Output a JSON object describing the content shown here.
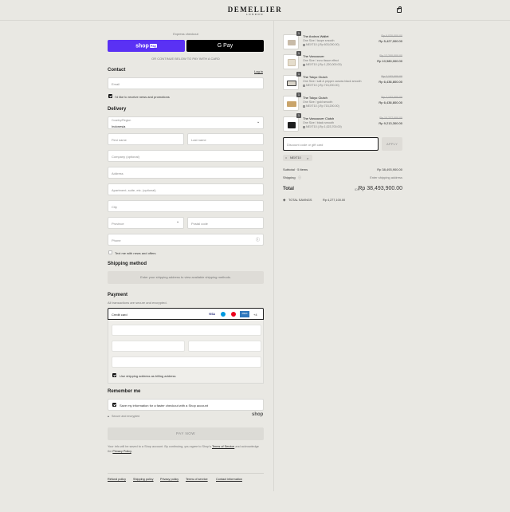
{
  "header": {
    "brand": "DEMELLIER",
    "brand_sub": "LONDON",
    "cart_icon": "shopping-bag-icon"
  },
  "express": {
    "label": "Express checkout",
    "shop_pay": "shop",
    "shop_pay_badge": "Pay",
    "gpay": "G Pay",
    "or_text": "OR CONTINUE BELOW TO PAY WITH A CARD"
  },
  "contact": {
    "title": "Contact",
    "login": "Log in",
    "email_placeholder": "Email",
    "news_label": "I'd like to receive news and promotions"
  },
  "delivery": {
    "title": "Delivery",
    "country_label": "Country/Region",
    "country_value": "Indonesia",
    "first_name": "First name",
    "last_name": "Last name",
    "company": "Company (optional)",
    "address": "Address",
    "apartment": "Apartment, suite, etc. (optional)",
    "city": "City",
    "province": "Province",
    "postal": "Postal code",
    "phone": "Phone",
    "text_me": "Text me with news and offers"
  },
  "shipping": {
    "title": "Shipping method",
    "placeholder": "Enter your shipping address to view available shipping methods."
  },
  "payment": {
    "title": "Payment",
    "subtitle": "All transactions are secure and encrypted.",
    "credit_card": "Credit card",
    "cards": [
      "VISA",
      "MC",
      "MC",
      "AMEX"
    ],
    "more_cards": "+4",
    "billing_same": "Use shipping address as billing address"
  },
  "remember": {
    "title": "Remember me",
    "save_label": "Save my information for a faster checkout with a Shop account",
    "secure": "Secure and encrypted",
    "shop_logo": "shop"
  },
  "pay_now": "PAY NOW",
  "legal": {
    "text_before": "Your info will be saved to a Shop account. By continuing, you agree to Shop's",
    "terms": "Terms of Service",
    "text_mid": "and acknowledge the",
    "privacy": "Privacy Policy",
    "text_end": "."
  },
  "footer_links": [
    "Refund policy",
    "Shipping policy",
    "Privacy policy",
    "Terms of service",
    "Contact information"
  ],
  "cart": {
    "items": [
      {
        "name": "The Andros Wallet",
        "variant": "One Size / taupe smooth",
        "discount": "NEXT10 (-Rp 603,000.00)",
        "old_price": "Rp 6,030,000.00",
        "price": "Rp 5,427,000.00",
        "qty": "1",
        "color": "#c8bba8"
      },
      {
        "name": "The Vancouver",
        "variant": "One Size / ecru tissue effect",
        "discount": "NEXT10 (-Rp 1,220,000.00)",
        "old_price": "Rp 12,200,000.00",
        "price": "Rp 10,980,000.00",
        "qty": "1",
        "color": "#e5ddcc"
      },
      {
        "name": "The Tokyo Clutch",
        "variant": "One Size / salt & pepper canvas black smooth",
        "discount": "NEXT10 (-Rp 715,200.00)",
        "old_price": "Rp 7,152,000.00",
        "price": "Rp 6,436,800.00",
        "qty": "1",
        "color": "#3a3a3a"
      },
      {
        "name": "The Tokyo Clutch",
        "variant": "One Size / gold smooth",
        "discount": "NEXT10 (-Rp 715,200.00)",
        "old_price": "Rp 7,152,000.00",
        "price": "Rp 6,436,800.00",
        "qty": "1",
        "color": "#c9a46a"
      },
      {
        "name": "The Vancouver Clutch",
        "variant": "One Size / black smooth",
        "discount": "NEXT10 (-Rp 1,023,700.00)",
        "old_price": "Rp 10,237,000.00",
        "price": "Rp 9,213,300.00",
        "qty": "1",
        "color": "#1e1e1e"
      }
    ],
    "discount_placeholder": "Discount code or gift card",
    "apply": "APPLY",
    "code_tag": "NEXT10",
    "subtotal_label": "Subtotal · 5 items",
    "subtotal_value": "Rp 38,493,900.00",
    "shipping_label": "Shipping",
    "shipping_value": "Enter shipping address",
    "total_label": "Total",
    "total_currency": "IDR",
    "total_value": "Rp 38,493,900.00",
    "savings_label": "TOTAL SAVINGS",
    "savings_value": "Rp 4,277,100.00"
  }
}
